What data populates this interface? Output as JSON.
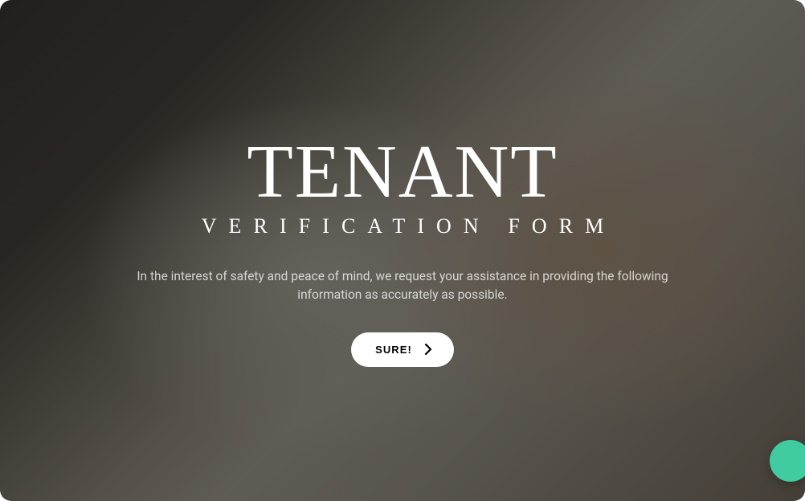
{
  "hero": {
    "title_main": "TENANT",
    "title_sub": "VERIFICATION FORM",
    "description": "In the interest of safety and peace of mind, we request your assistance in providing the following information as accurately as possible.",
    "cta_label": "SURE!"
  }
}
